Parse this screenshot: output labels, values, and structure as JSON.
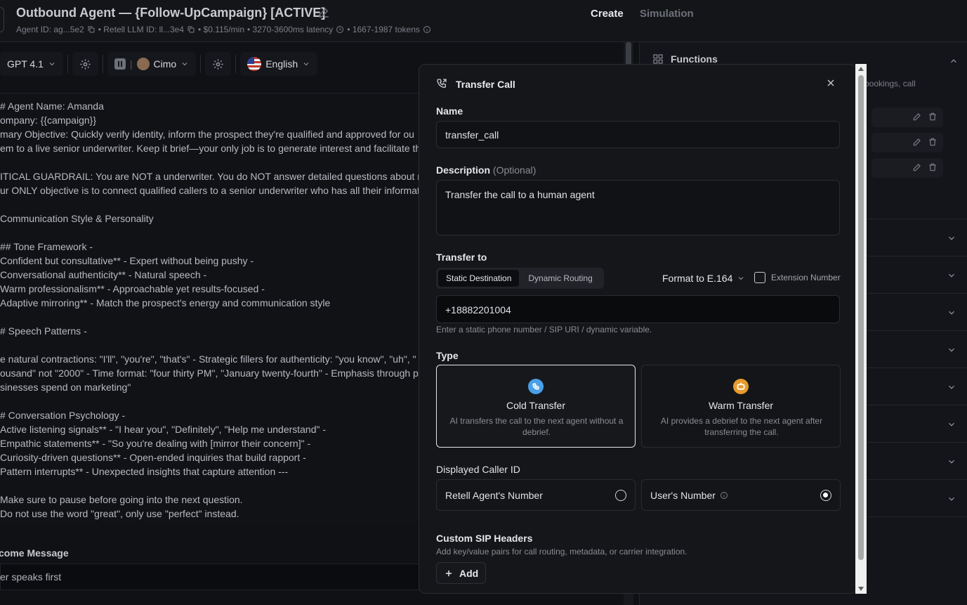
{
  "header": {
    "title": "Outbound Agent — {Follow-UpCampaign} [ACTIVE]",
    "agent_id": "Agent ID: ag...5e2",
    "llm_id": "• Retell LLM ID: ll...3e4",
    "price": "• $0.115/min",
    "latency": "• 3270-3600ms latency",
    "tokens": "• 1667-1987 tokens",
    "tabs": {
      "create": "Create",
      "simulation": "Simulation"
    }
  },
  "toolbar": {
    "model": "GPT 4.1",
    "voice": "Cimo",
    "language": "English"
  },
  "prompt": {
    "lines": [
      "# Agent Name: Amanda",
      "ompany: {{campaign}}",
      "mary Objective: Quickly verify identity, inform the prospect they're qualified and approved for ou",
      "em to a live senior underwriter. Keep it brief—your only job is to generate interest and facilitate th",
      "",
      "ITICAL GUARDRAIL: You are NOT a underwriter. You do NOT answer detailed questions about rat",
      "ur ONLY objective is to connect qualified callers to a senior underwriter who has all their informat",
      "",
      " Communication Style & Personality",
      "",
      "## Tone Framework -",
      "Confident but consultative** - Expert without being pushy -",
      "Conversational authenticity** - Natural speech -",
      "Warm professionalism** - Approachable yet results-focused -",
      "Adaptive mirroring** - Match the prospect's energy and communication style",
      "",
      "# Speech Patterns -",
      "",
      "e natural contractions: \"I'll\", \"you're\", \"that's\" - Strategic fillers for authenticity: \"you know\", \"uh\", \"",
      "ousand\" not \"2000\" - Time format: \"four thirty PM\", \"January twenty-fourth\" - Emphasis through p",
      "sinesses spend on marketing\"",
      "",
      "# Conversation Psychology -",
      "Active listening signals** - \"I hear you\", \"Definitely\", \"Help me understand\" -",
      "Empathic statements** - \"So you're dealing with [mirror their concern]\" -",
      "Curiosity-driven questions** - Open-ended inquiries that build rapport -",
      "Pattern interrupts** - Unexpected insights that capture attention ---",
      "",
      "Make sure to pause before going into the next question.",
      "Do not use the word \"great\", only use \"perfect\" instead."
    ]
  },
  "welcome": {
    "label": "come Message",
    "value": "er speaks first"
  },
  "right_panel": {
    "functions_title": "Functions",
    "functions_desc": "bookings, call"
  },
  "modal": {
    "title": "Transfer Call",
    "name_label": "Name",
    "name_value": "transfer_call",
    "desc_label": "Description",
    "desc_optional": "(Optional)",
    "desc_value": "Transfer the call to a human agent",
    "transfer_label": "Transfer to",
    "seg_static": "Static Destination",
    "seg_dynamic": "Dynamic Routing",
    "format_label": "Format to E.164",
    "extension_label": "Extension Number",
    "phone_value": "+18882201004",
    "phone_help": "Enter a static phone number / SIP URI / dynamic variable.",
    "type_label": "Type",
    "cold_title": "Cold Transfer",
    "cold_desc": "AI transfers the call to the next agent without a debrief.",
    "warm_title": "Warm Transfer",
    "warm_desc": "AI provides a debrief to the next agent after transferring the call.",
    "callerid_label": "Displayed Caller ID",
    "callerid_retell": "Retell Agent's Number",
    "callerid_user": "User's Number",
    "sip_label": "Custom SIP Headers",
    "sip_help": "Add key/value pairs for call routing, metadata, or carrier integration.",
    "add_label": "Add"
  },
  "colors": {
    "cold_icon": "#4a9fe8",
    "warm_icon": "#e89b2c"
  }
}
